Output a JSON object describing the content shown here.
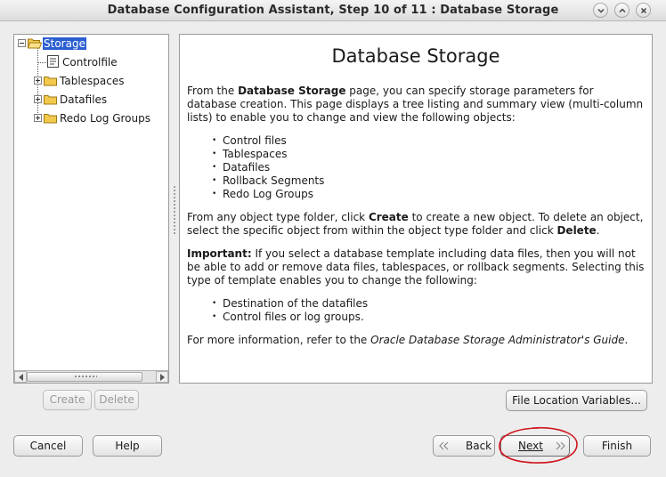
{
  "window": {
    "title": "Database Configuration Assistant, Step 10 of 11 : Database Storage",
    "minimize_icon": "chevron-down-icon",
    "maximize_icon": "chevron-up-icon",
    "close_icon": "close-icon"
  },
  "tree": {
    "root": {
      "label": "Storage",
      "icon": "folder-open-icon",
      "expanded": true,
      "selected": true
    },
    "children": [
      {
        "label": "Controlfile",
        "icon": "document-icon",
        "expandable": false
      },
      {
        "label": "Tablespaces",
        "icon": "folder-icon",
        "expandable": true
      },
      {
        "label": "Datafiles",
        "icon": "folder-icon",
        "expandable": true
      },
      {
        "label": "Redo Log Groups",
        "icon": "folder-icon",
        "expandable": true
      }
    ]
  },
  "content": {
    "title": "Database Storage",
    "intro": {
      "p1": "From the ",
      "b1": "Database Storage",
      "p2": " page, you can specify storage parameters for database creation. This page displays a tree listing and summary view (multi-column lists) to enable you to change and view the following objects:"
    },
    "objects": [
      "Control files",
      "Tablespaces",
      "Datafiles",
      "Rollback Segments",
      "Redo Log Groups"
    ],
    "create_para": {
      "p1": "From any object type folder, click ",
      "b1": "Create",
      "p2": " to create a new object. To delete an object, select the specific object from within the object type folder and click ",
      "b2": "Delete",
      "p3": "."
    },
    "important_para": {
      "b1": "Important:",
      "p1": " If you select a database template including data files, then you will not be able to add or remove data files, tablespaces, or rollback segments. Selecting this type of template enables you to change the following:"
    },
    "template_items": [
      "Destination of the datafiles",
      "Control files or log groups."
    ],
    "more_info": {
      "p1": "For more information, refer to the ",
      "i1": "Oracle Database Storage Administrator's Guide",
      "p2": "."
    }
  },
  "buttons": {
    "create": "Create",
    "delete": "Delete",
    "file_location_variables": "File Location Variables...",
    "cancel": "Cancel",
    "help": "Help",
    "back": "Back",
    "next": "Next",
    "finish": "Finish"
  },
  "colors": {
    "selection": "#2b5ecf",
    "annotation": "#d0141c",
    "folder": "#f2c94c"
  }
}
